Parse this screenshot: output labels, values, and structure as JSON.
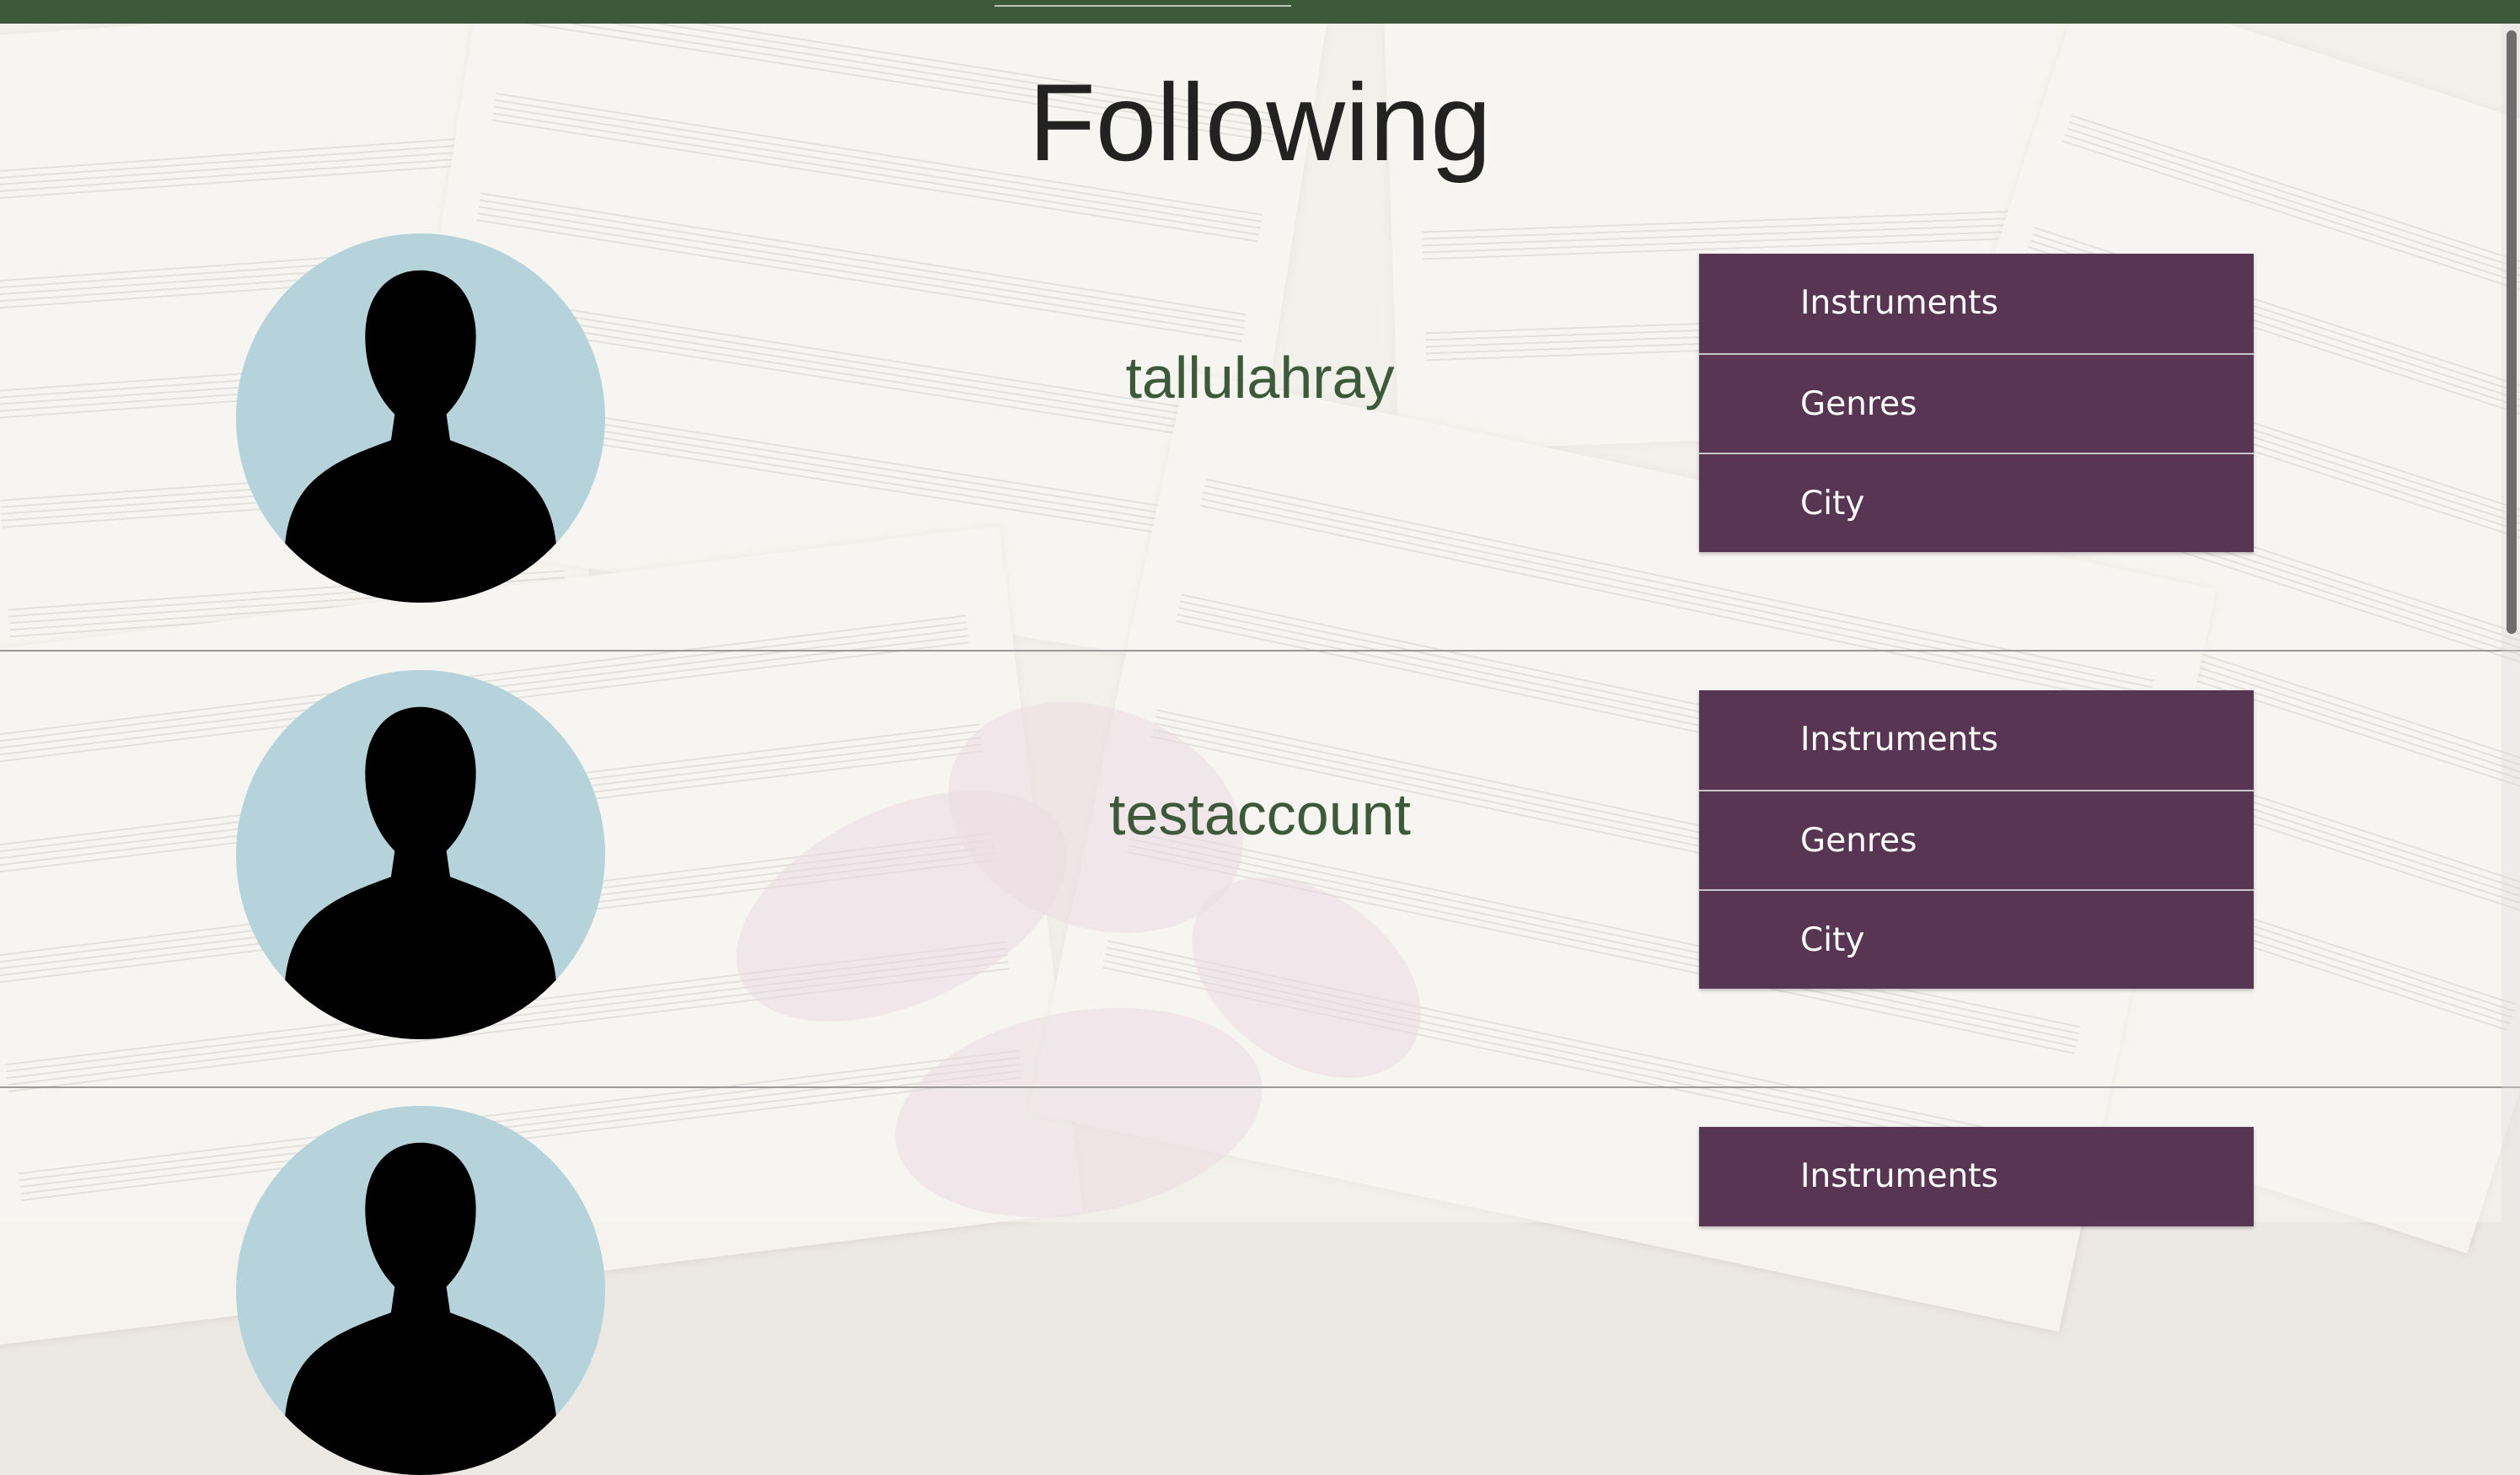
{
  "header": {
    "title": "Following"
  },
  "following": [
    {
      "username": "tallulahray",
      "menu": [
        "Instruments",
        "Genres",
        "City"
      ]
    },
    {
      "username": "testaccount",
      "menu": [
        "Instruments",
        "Genres",
        "City"
      ]
    },
    {
      "menu": [
        "Instruments"
      ]
    }
  ],
  "icons": {
    "avatar": "person-silhouette-icon"
  },
  "colors": {
    "topbar": "#3c5a3a",
    "username": "#3c5a3a",
    "menu_background": "#573553",
    "menu_text": "#ffffff",
    "avatar_background": "#b6d3dc"
  }
}
